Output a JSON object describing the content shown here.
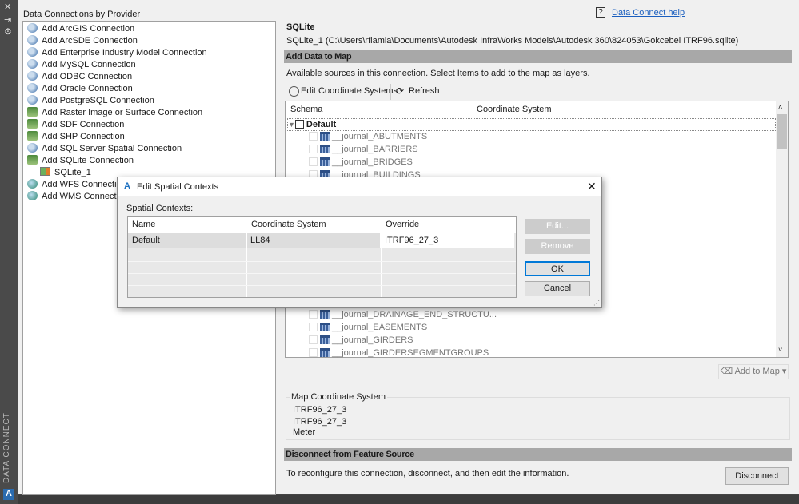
{
  "sidebar": {
    "vertical_label": "DATA CONNECT",
    "close_icon": "✕",
    "pin_icon": "⇥",
    "settings_icon": "⚙"
  },
  "left": {
    "title": "Data Connections by Provider",
    "items": [
      {
        "label": "Add ArcGIS Connection"
      },
      {
        "label": "Add ArcSDE Connection"
      },
      {
        "label": "Add Enterprise Industry Model Connection"
      },
      {
        "label": "Add MySQL Connection"
      },
      {
        "label": "Add ODBC Connection"
      },
      {
        "label": "Add Oracle Connection"
      },
      {
        "label": "Add PostgreSQL Connection"
      },
      {
        "label": "Add Raster Image or Surface Connection"
      },
      {
        "label": "Add SDF Connection"
      },
      {
        "label": "Add SHP Connection"
      },
      {
        "label": "Add SQL Server Spatial Connection"
      },
      {
        "label": "Add SQLite Connection"
      },
      {
        "label": "SQLite_1"
      },
      {
        "label": "Add WFS Connection"
      },
      {
        "label": "Add WMS Connection"
      }
    ]
  },
  "right": {
    "help_link": "Data Connect help",
    "provider": "SQLite",
    "connection_path": "SQLite_1 (C:\\Users\\rflamia\\Documents\\Autodesk InfraWorks Models\\Autodesk 360\\824053\\Gokcebel ITRF96.sqlite)",
    "add_data_header": "Add Data to Map",
    "available_text": "Available sources in this connection.  Select Items to add to the map as layers.",
    "toolbar": {
      "edit_cs": "Edit Coordinate Systems",
      "refresh": "Refresh"
    },
    "grid": {
      "columns": [
        "Schema",
        "Coordinate System"
      ],
      "group": "Default",
      "rows": [
        "__journal_ABUTMENTS",
        "__journal_BARRIERS",
        "__journal_BRIDGES",
        "__journal_BUILDINGS",
        "__journal_DRAINAGE_END_STRUCTU...",
        "__journal_EASEMENTS",
        "__journal_GIRDERS",
        "__journal_GIRDERSEGMENTGROUPS"
      ]
    },
    "add_to_map": "Add to Map",
    "map_cs": {
      "title": "Map Coordinate System",
      "lines": [
        "ITRF96_27_3",
        "ITRF96_27_3",
        "Meter"
      ]
    },
    "disconnect_header": "Disconnect from Feature Source",
    "disconnect_text": "To reconfigure this connection, disconnect, and then edit the information.",
    "disconnect_button": "Disconnect"
  },
  "dialog": {
    "title": "Edit Spatial Contexts",
    "label": "Spatial Contexts:",
    "columns": [
      "Name",
      "Coordinate System",
      "Override"
    ],
    "rows": [
      {
        "name": "Default",
        "cs": "LL84",
        "override": "ITRF96_27_3"
      }
    ],
    "buttons": {
      "edit": "Edit...",
      "remove": "Remove",
      "ok": "OK",
      "cancel": "Cancel"
    }
  }
}
